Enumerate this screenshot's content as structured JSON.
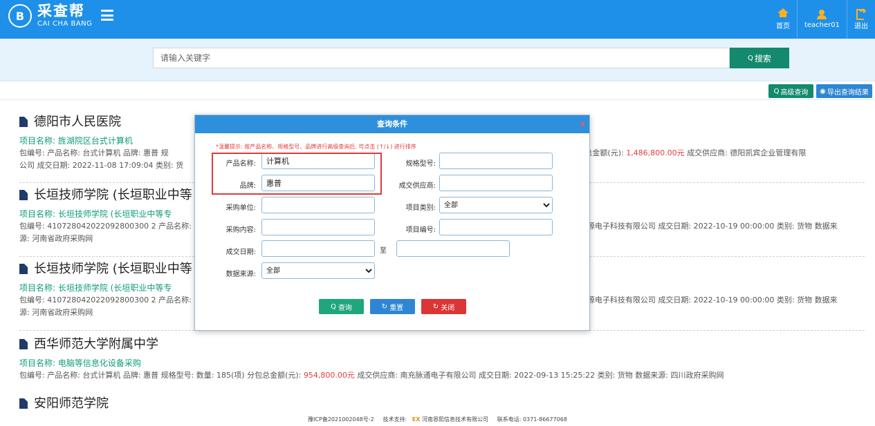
{
  "header": {
    "logo_mark": "B",
    "logo_cn": "采查帮",
    "logo_en": "CAI CHA BANG",
    "nav": [
      {
        "label": "首页",
        "icon": "home-icon"
      },
      {
        "label": "teacher01",
        "icon": "user-icon"
      },
      {
        "label": "退出",
        "icon": "logout-icon"
      }
    ]
  },
  "search": {
    "placeholder": "请输入关键字",
    "button_label": "搜索",
    "button_icon": "Q"
  },
  "toolbar": {
    "advanced_label": "高级查询",
    "export_label": "导出查询结果"
  },
  "results": [
    {
      "title": "德阳市人民医院",
      "project": "项目名称: 旌湖院区台式计算机",
      "detail_line1_left": "包编号:   产品名称: 台式计算机 品牌: 惠普 规",
      "detail_line1_right_pre": ") 分包总金额(元): ",
      "amount": "1,486,800.00元",
      "detail_line1_right_post": " 成交供应商: 德阳凯宾企业管理有限",
      "detail_line2": "公司 成交日期: 2022-11-08 17:09:04 类别: 货"
    },
    {
      "title": "长垣技师学院 (长垣职业中等",
      "project": "项目名称: 长垣技师学院 (长垣职业中等专",
      "detail_line1_left": "包编号: 410728042022092800300 2 产品名称:",
      "detail_line1_right": "源电子科技有限公司 成交日期: 2022-10-19 00:00:00 类别: 货物 数据来",
      "detail_line2": "源: 河南省政府采购网"
    },
    {
      "title": "长垣技师学院 (长垣职业中等",
      "project": "项目名称: 长垣技师学院 (长垣职业中等专",
      "detail_line1_left": "包编号: 410728042022092800300 2 产品名称:",
      "detail_line1_right": "源电子科技有限公司 成交日期: 2022-10-19 00:00:00 类别: 货物 数据来",
      "detail_line2": "源: 河南省政府采购网"
    },
    {
      "title": "西华师范大学附属中学",
      "project": "项目名称: 电脑等信息化设备采购",
      "detail_line1_pre": "包编号:   产品名称: 台式计算机 品牌: 惠普 规格型号:   数量: 185(项) 分包总金额(元): ",
      "amount": "954,800.00元",
      "detail_line1_post": " 成交供应商: 南充脉通电子有限公司 成交日期: 2022-09-13 15:25:22 类别: 货物 数据来源: 四川政府采购网"
    },
    {
      "title": "安阳师范学院"
    }
  ],
  "footer": {
    "icp": "豫ICP备2021002048号-2",
    "support_label": "技术支持:",
    "ex_mark": "EX",
    "company": "河南恩熙信息技术有限公司",
    "phone": "联系电话: 0371-86677068"
  },
  "modal": {
    "title": "查询条件",
    "close": "x",
    "tip": "*温馨提示: 按产品名称、规格型号、品牌进行高级查询后, 可点击 (↑/↓) 进行排序",
    "fields": {
      "product_name_label": "产品名称:",
      "product_name_value": "计算机",
      "spec_label": "规格型号:",
      "spec_value": "",
      "brand_label": "品牌:",
      "brand_value": "惠普",
      "supplier_label": "成交供应商:",
      "supplier_value": "",
      "buyer_label": "采购单位:",
      "buyer_value": "",
      "category_label": "项目类别:",
      "category_value": "全部",
      "content_label": "采购内容:",
      "content_value": "",
      "project_no_label": "项目编号:",
      "project_no_value": "",
      "date_label": "成交日期:",
      "date_to": "至",
      "source_label": "数据来源:",
      "source_value": "全部"
    },
    "buttons": {
      "query": "查询",
      "reset": "重置",
      "close": "关闭"
    }
  },
  "colors": {
    "header_bg": "#1e90ea",
    "search_btn": "#138a6d",
    "amount": "#e23c3c",
    "project_text": "#0f9b7c",
    "highlight_box": "#e0393b"
  }
}
